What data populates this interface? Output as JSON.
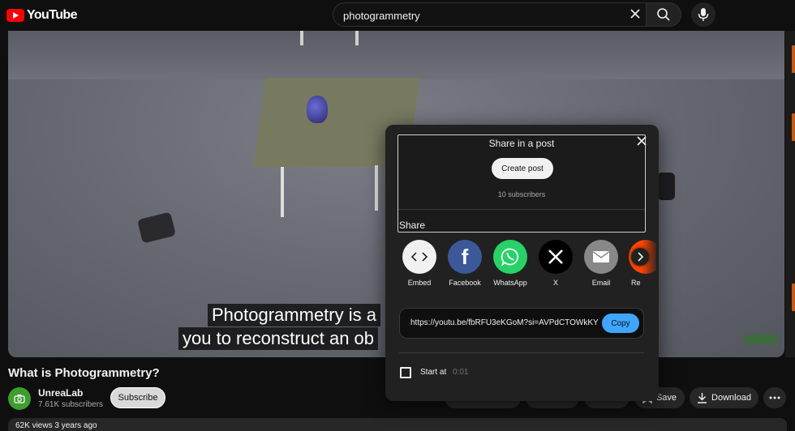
{
  "app": {
    "logo_text": "YouTube"
  },
  "search": {
    "query": "photogrammetry",
    "placeholder": "Search"
  },
  "video": {
    "title": "What is Photogrammetry?",
    "caption_line1": "Photogrammetry is a",
    "caption_line2": "you to reconstruct an ob",
    "meta": "62K views  3 years ago"
  },
  "channel": {
    "name": "UnreaLab",
    "subscribers": "7.61K subscribers",
    "subscribe_label": "Subscribe"
  },
  "actions": {
    "save_label": "Save",
    "download_label": "Download"
  },
  "share_dialog": {
    "post_title": "Share in a post",
    "create_post_label": "Create post",
    "post_subscribers": "10 subscribers",
    "share_label": "Share",
    "targets": [
      {
        "label": "Embed",
        "color": "#f1f1f1",
        "icon": "embed-icon"
      },
      {
        "label": "Facebook",
        "color": "#3b5998",
        "icon": "facebook-icon"
      },
      {
        "label": "WhatsApp",
        "color": "#25d366",
        "icon": "whatsapp-icon"
      },
      {
        "label": "X",
        "color": "#000000",
        "icon": "x-icon"
      },
      {
        "label": "Email",
        "color": "#888888",
        "icon": "email-icon"
      },
      {
        "label": "Re",
        "color": "#ff4500",
        "icon": "reddit-icon"
      }
    ],
    "url": "https://youtu.be/fbRFU3eKGoM?si=AVPdCTOWkKY",
    "copy_label": "Copy",
    "start_at_label": "Start at",
    "start_at_time": "0:01"
  }
}
